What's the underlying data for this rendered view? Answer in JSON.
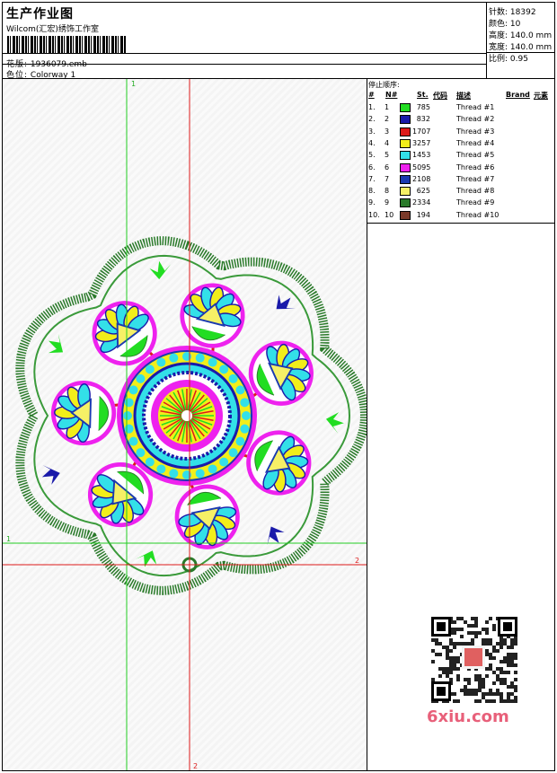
{
  "header": {
    "title": "生产作业图",
    "company": "Wilcom(汇宏)绣饰工作室",
    "design_label": "花版:",
    "design_value": "1936079.emb",
    "colorway_label": "色位:",
    "colorway_value": "Colorway 1"
  },
  "stats": [
    {
      "label": "针数:",
      "value": "18392"
    },
    {
      "label": "颜色:",
      "value": "10"
    },
    {
      "label": "高度:",
      "value": "140.0 mm"
    },
    {
      "label": "宽度:",
      "value": "140.0 mm"
    },
    {
      "label": "比例:",
      "value": "0.95"
    }
  ],
  "stop_sequence": {
    "title": "停止顺序:",
    "columns": [
      "#",
      "N#",
      "St.",
      "代码",
      "描述",
      "Brand",
      "元素"
    ],
    "rows": [
      {
        "idx": "1.",
        "n": "1",
        "color": "#22dd22",
        "st": "785",
        "desc": "Thread #1"
      },
      {
        "idx": "2.",
        "n": "2",
        "color": "#1a1aaa",
        "st": "832",
        "desc": "Thread #2"
      },
      {
        "idx": "3.",
        "n": "3",
        "color": "#dd1a1a",
        "st": "1707",
        "desc": "Thread #3"
      },
      {
        "idx": "4.",
        "n": "4",
        "color": "#f2ee1a",
        "st": "3257",
        "desc": "Thread #4"
      },
      {
        "idx": "5.",
        "n": "5",
        "color": "#33e0e8",
        "st": "1453",
        "desc": "Thread #5"
      },
      {
        "idx": "6.",
        "n": "6",
        "color": "#ee22ee",
        "st": "5095",
        "desc": "Thread #6"
      },
      {
        "idx": "7.",
        "n": "7",
        "color": "#1a3ab0",
        "st": "2108",
        "desc": "Thread #7"
      },
      {
        "idx": "8.",
        "n": "8",
        "color": "#f6f066",
        "st": "625",
        "desc": "Thread #8"
      },
      {
        "idx": "9.",
        "n": "9",
        "color": "#2a7a2a",
        "st": "2334",
        "desc": "Thread #9"
      },
      {
        "idx": "10.",
        "n": "10",
        "color": "#7a3a2a",
        "st": "194",
        "desc": "Thread #10"
      }
    ]
  },
  "guides": {
    "v1": "1",
    "v2": "2",
    "h1": "1",
    "h2": "2"
  },
  "watermark": "6xiu.com"
}
